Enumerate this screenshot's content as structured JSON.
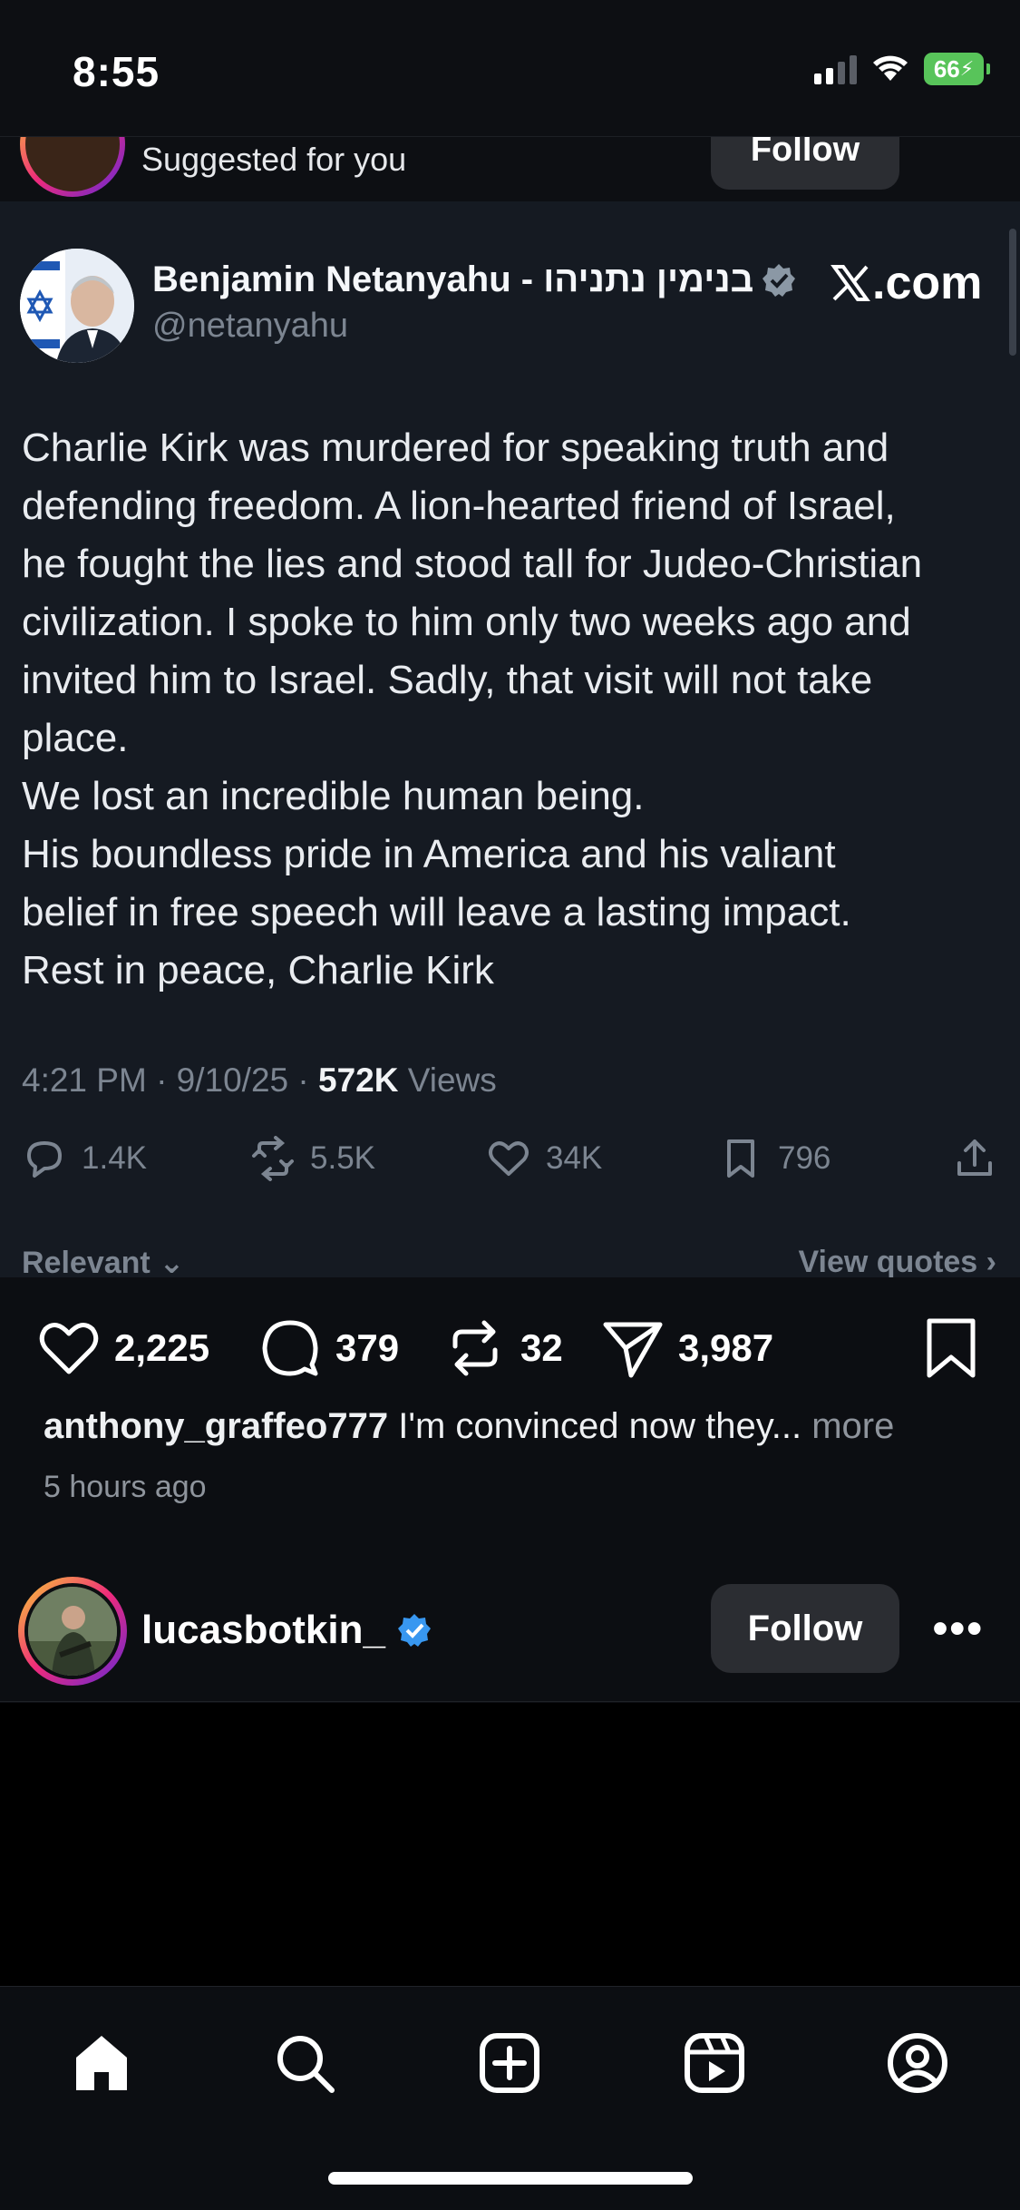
{
  "status_bar": {
    "time": "8:55",
    "battery": "66"
  },
  "suggested": {
    "label": "Suggested for you",
    "follow_label": "Follow"
  },
  "x_post": {
    "author_name": "Benjamin Netanyahu - בנימין נתניהו",
    "handle": "@netanyahu",
    "brand": ".com",
    "body_lines": [
      "Charlie Kirk was murdered for speaking truth and",
      "defending freedom. A lion-hearted friend of Israel,",
      "he fought the lies and stood tall for Judeo-Christian",
      "civilization. I spoke to him only two weeks ago and",
      "invited him to Israel. Sadly, that visit will not take",
      "place.",
      "We lost an incredible human being.",
      "His boundless pride in America and his valiant",
      "belief in free speech will leave a lasting impact.",
      "Rest in peace, Charlie Kirk"
    ],
    "timestamp": "4:21 PM · 9/10/25 · ",
    "views_count": "572K",
    "views_label": " Views",
    "replies": "1.4K",
    "reposts": "5.5K",
    "likes": "34K",
    "bookmarks": "796",
    "filter_label": "Relevant",
    "quotes_label": "View quotes"
  },
  "ig_post": {
    "likes": "2,225",
    "comments": "379",
    "reposts": "32",
    "shares": "3,987",
    "caption_user": "anthony_graffeo777",
    "caption_text": " I'm convinced now they... ",
    "caption_more": "more",
    "time_ago": "5 hours ago"
  },
  "next_post": {
    "username": "lucasbotkin_",
    "follow_label": "Follow",
    "more_label": "•••"
  },
  "colors": {
    "background": "#0c0e12",
    "x_card": "#151a22",
    "verified_blue": "#3897f0",
    "muted": "#7c8591"
  },
  "nav": {
    "items": [
      "home-icon",
      "search-icon",
      "create-icon",
      "reels-icon",
      "profile-icon"
    ]
  }
}
